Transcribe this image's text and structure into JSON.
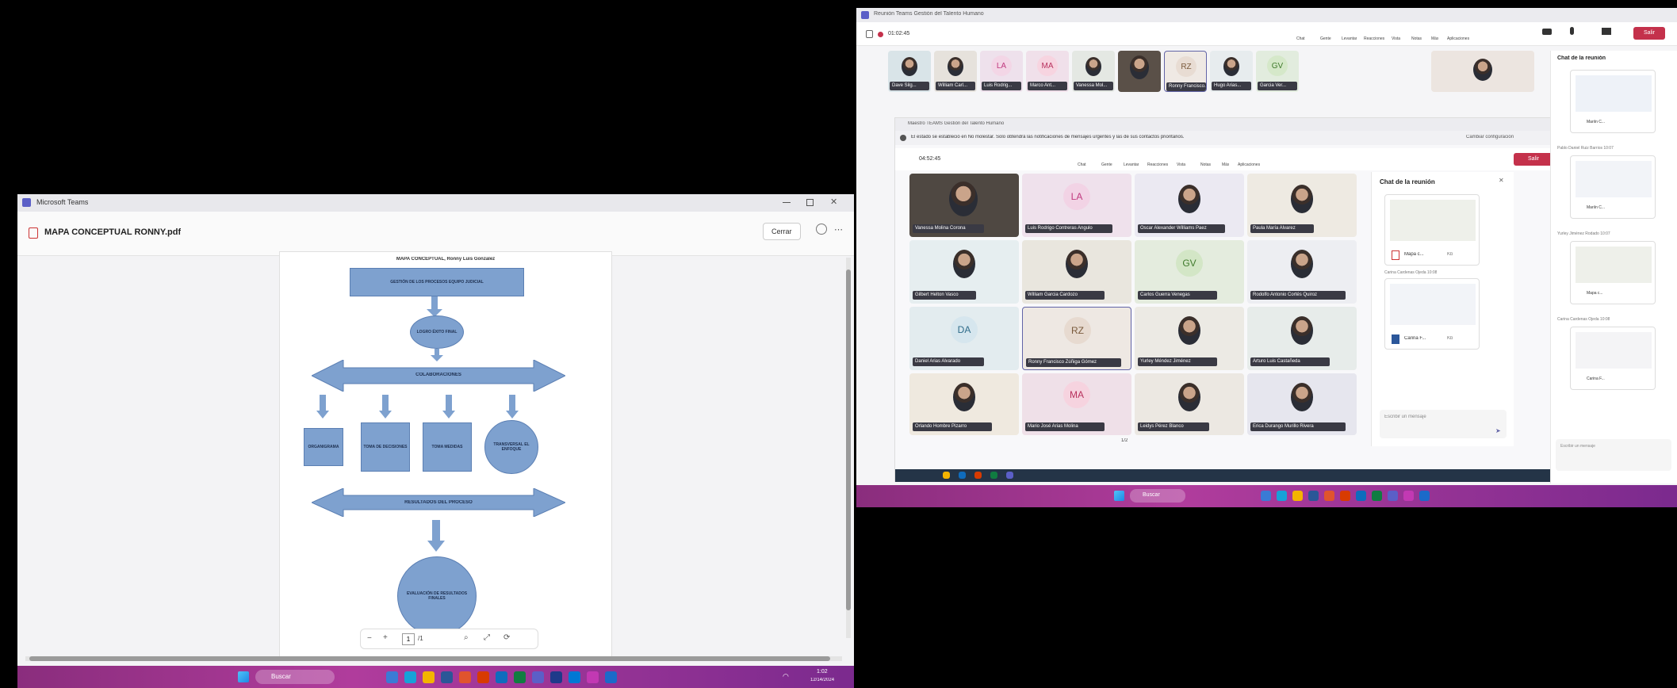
{
  "left_window": {
    "app_title": "Microsoft Teams",
    "file_name": "MAPA CONCEPTUAL RONNY.pdf",
    "close_button": "Cerrar",
    "pdf": {
      "heading": "MAPA CONCEPTUAL, Ronny Luis Gonzalez",
      "top_box": "GESTIÓN DE LOS PROCESOS EQUIPO JUDICIAL",
      "circle_1": "LOGRO ÉXITO FINAL",
      "banner_1": "COLABORACIONES",
      "branches": [
        "ORGANIGRAMA",
        "TOMA DE DECISIONES",
        "TOMA MEDIDAS",
        "TRANSVERSAL EL ENFOQUE"
      ],
      "banner_2": "RESULTADOS DEL PROCESO",
      "circle_2": "EVALUACIÓN DE RESULTADOS FINALES"
    },
    "page_indicator": "1",
    "page_total": "/1"
  },
  "left_taskbar": {
    "search_placeholder": "Buscar",
    "time": "1:02",
    "date": "12/14/2024"
  },
  "teams": {
    "window_title": "Reunión Teams Gestión del Talento Humano",
    "call_timer": "01:02:45",
    "leave_label": "Salir",
    "toolbar_items": [
      "Chat",
      "Gente",
      "Levantar",
      "Reacciones",
      "Vista",
      "Notas",
      "Más",
      "Aplicaciones",
      "Más"
    ],
    "top_strip_names": [
      "Dave Silg...",
      "William Carl...",
      "Luis Rodrig...",
      "Marco Ant...",
      "Vanessa Mol...",
      "",
      "Ronny Francisco...",
      "Hugo Arias...",
      "Garcia Ver..."
    ],
    "top_strip_initials": [
      "LA",
      "MA",
      "RZ",
      "GV"
    ],
    "inner_title": "Maestro TEAMS Gestión del Talento Humano",
    "notice": "El estado se estableció en No molestar. Solo obtendrá las notificaciones de mensajes urgentes y las de sus contactos prioritarios.",
    "notice_link": "Cambiar configuración",
    "inner_timer": "04:52:45",
    "inner_toolbar": [
      "Chat",
      "Gente",
      "Levantar",
      "Reacciones",
      "Vista",
      "Notas",
      "Más",
      "Aplicaciones",
      "Más"
    ],
    "grid": [
      {
        "name": "Vanessa Molina Corona",
        "initials": ""
      },
      {
        "name": "Luis Rodrigo Contreras Angulo",
        "initials": "LA"
      },
      {
        "name": "Oscar Alexander Williams Paez",
        "initials": ""
      },
      {
        "name": "Paula María Alvarez",
        "initials": ""
      },
      {
        "name": "Gilbert Helton Vasco",
        "initials": ""
      },
      {
        "name": "William Garcia Cardozo",
        "initials": ""
      },
      {
        "name": "Carlos Guerra Venegas",
        "initials": "GV"
      },
      {
        "name": "Rodolfo Antonio Cortés Quiroz",
        "initials": ""
      },
      {
        "name": "Daniel Arias Alvarado",
        "initials": "DA"
      },
      {
        "name": "Ronny Francisco Zúñiga Gómez",
        "initials": "RZ"
      },
      {
        "name": "Yurley Méndez Jiménez",
        "initials": ""
      },
      {
        "name": "Arturo Luis Castañeda",
        "initials": ""
      },
      {
        "name": "Orlando Hombre Pizarro",
        "initials": ""
      },
      {
        "name": "Mario José Arias Molina",
        "initials": "MA"
      },
      {
        "name": "Leidys Pérez Blanco",
        "initials": ""
      },
      {
        "name": "Erica Durango Murillo Rivera",
        "initials": ""
      }
    ],
    "page_indicator": "1/2",
    "chat_title": "Chat de la reunión",
    "chat_messages": [
      {
        "sender": "",
        "file": "Mapa c...",
        "ext": "Kb"
      },
      {
        "sender": "Carina Cardenas Ojeda  10:08",
        "file": "",
        "ext": ""
      },
      {
        "sender": "",
        "file": "Carina F...",
        "ext": "Kb"
      }
    ],
    "chat_input_placeholder": "Escribir un mensaje",
    "outer_chat_title": "Chat de la reunión",
    "outer_chat_messages": [
      {
        "sender": "",
        "file": "Mariín C...",
        "ext": "Kb"
      },
      {
        "sender": "Pablo Daniel Ruiz Barrios  10:07",
        "file": "Mariín C...",
        "ext": "Kb"
      },
      {
        "sender": "Yurley Jiménez Rodado  10:07",
        "file": "Mapa c...",
        "ext": "Kb"
      },
      {
        "sender": "Carina Cardenas Ojeda  10:08",
        "file": "Carina F...",
        "ext": "Kb"
      }
    ],
    "outer_chat_placeholder": "Escribir un mensaje",
    "taskbar_search": "Buscar"
  },
  "colors": {
    "diagram_fill": "#7ea1cf",
    "teams_accent": "#6264a7",
    "leave_red": "#c4314b",
    "taskbar": "#9b3592"
  }
}
